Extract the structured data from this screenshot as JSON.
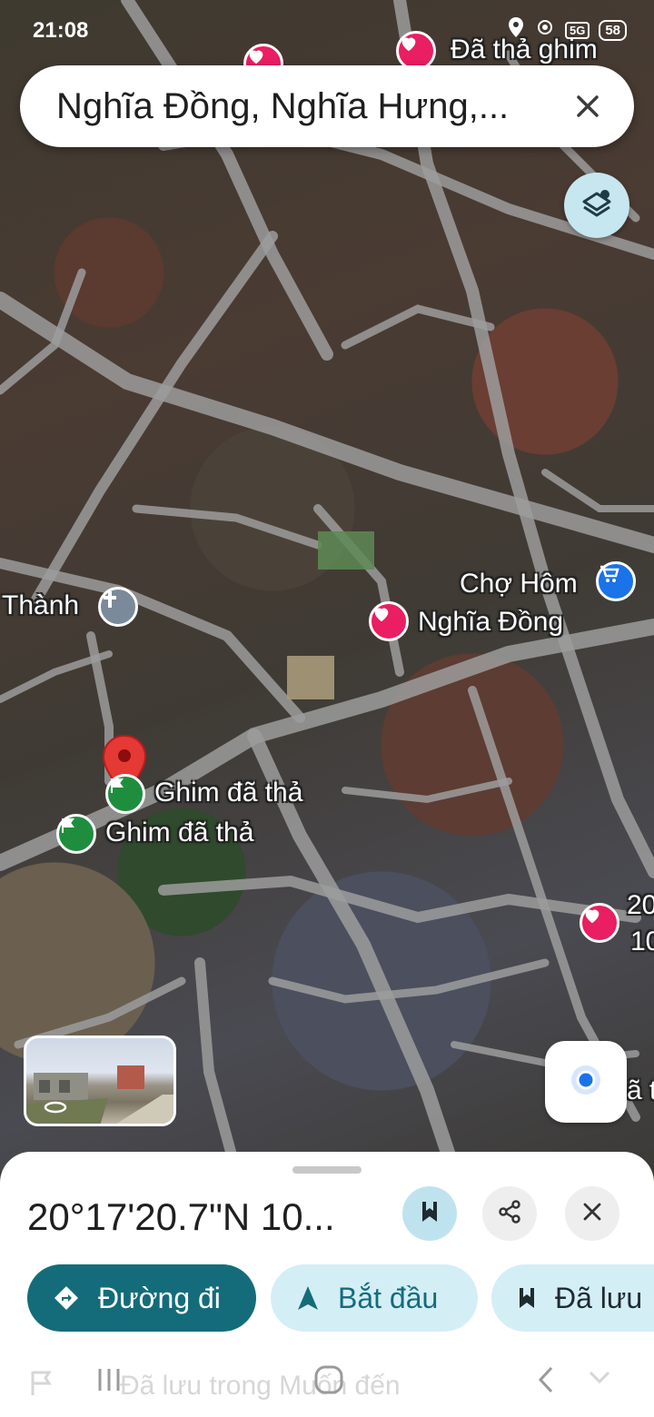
{
  "status_bar": {
    "time": "21:08",
    "network": "5G",
    "battery": "58"
  },
  "search": {
    "query": "Nghĩa Đồng, Nghĩa Hưng,..."
  },
  "map": {
    "labels": {
      "top_pin": "Đã thả ghim",
      "thanh": "Thành",
      "cho_hom": "Chợ Hôm",
      "nghia_dong": "Nghĩa Đồng",
      "dropped_pin_1": "Ghim đã thả",
      "dropped_pin_2": "Ghim đã thả",
      "right_edge_1": "20",
      "right_edge_2": "10",
      "right_edge_3": "ã t"
    }
  },
  "sheet": {
    "coordinates": "20°17'20.7\"N 10...",
    "directions_label": "Đường đi",
    "start_label": "Bắt đầu",
    "saved_label": "Đã lưu",
    "ghost_text": "Đã lưu trong Muốn đến"
  },
  "colors": {
    "accent_dark": "#146c7a",
    "accent_light": "#d4eef6",
    "pin_red": "#e53935",
    "heart": "#e91e63",
    "flag": "#1e8e3e"
  }
}
